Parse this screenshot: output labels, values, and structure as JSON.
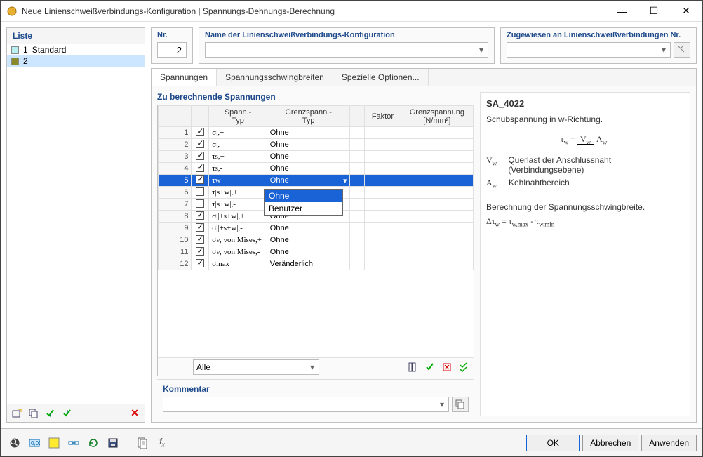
{
  "window": {
    "title": "Neue Linienschweißverbindungs-Konfiguration | Spannungs-Dehnungs-Berechnung"
  },
  "left": {
    "header": "Liste",
    "items": [
      {
        "num": "1",
        "label": "Standard",
        "swatch": "#b8f0f0",
        "selected": false
      },
      {
        "num": "2",
        "label": "",
        "swatch": "#8a8a2a",
        "selected": true
      }
    ]
  },
  "fields": {
    "nr_label": "Nr.",
    "nr_value": "2",
    "name_label": "Name der Linienschweißverbindungs-Konfiguration",
    "name_value": "",
    "assigned_label": "Zugewiesen an Linienschweißverbindungen Nr.",
    "assigned_value": ""
  },
  "tabs": [
    {
      "label": "Spannungen",
      "active": true
    },
    {
      "label": "Spannungsschwingbreiten",
      "active": false
    },
    {
      "label": "Spezielle Optionen...",
      "active": false
    }
  ],
  "section_title": "Zu berechnende Spannungen",
  "grid": {
    "headers": {
      "spann_typ": "Spann.-\nTyp",
      "grenz_typ": "Grenzspann.-\nTyp",
      "faktor": "Faktor",
      "grenzsp": "Grenzspannung\n[N/mm²]"
    },
    "rows": [
      {
        "n": "1",
        "chk": true,
        "typ": "σ|,+",
        "gtyp": "Ohne",
        "sel": false
      },
      {
        "n": "2",
        "chk": true,
        "typ": "σ|,-",
        "gtyp": "Ohne",
        "sel": false
      },
      {
        "n": "3",
        "chk": true,
        "typ": "τs,+",
        "gtyp": "Ohne",
        "sel": false
      },
      {
        "n": "4",
        "chk": true,
        "typ": "τs,-",
        "gtyp": "Ohne",
        "sel": false
      },
      {
        "n": "5",
        "chk": true,
        "typ": "τw",
        "gtyp": "Ohne",
        "sel": true
      },
      {
        "n": "6",
        "chk": false,
        "typ": "τ|s+w|,+",
        "gtyp": "",
        "sel": false
      },
      {
        "n": "7",
        "chk": false,
        "typ": "τ|s+w|,-",
        "gtyp": "",
        "sel": false
      },
      {
        "n": "8",
        "chk": true,
        "typ": "σ||+s+w|,+",
        "gtyp": "Ohne",
        "sel": false
      },
      {
        "n": "9",
        "chk": true,
        "typ": "σ||+s+w|,-",
        "gtyp": "Ohne",
        "sel": false
      },
      {
        "n": "10",
        "chk": true,
        "typ": "σv, von Mises,+",
        "gtyp": "Ohne",
        "sel": false
      },
      {
        "n": "11",
        "chk": true,
        "typ": "σv, von Mises,-",
        "gtyp": "Ohne",
        "sel": false
      },
      {
        "n": "12",
        "chk": true,
        "typ": "σmax",
        "gtyp": "Veränderlich",
        "sel": false
      }
    ],
    "dropdown": {
      "options": [
        "Ohne",
        "Benutzer"
      ],
      "highlighted": 0
    },
    "footer_combo": "Alle"
  },
  "info": {
    "code": "SA_4022",
    "desc": "Schubspannung in w-Richtung.",
    "formula_lhs": "τw",
    "formula_top": "Vw",
    "formula_bot": "Aw",
    "legend": [
      {
        "sym": "Vw",
        "txt": "Querlast der Anschlussnaht (Verbindungsebene)"
      },
      {
        "sym": "Aw",
        "txt": "Kehlnahtbereich"
      }
    ],
    "calc_title": "Berechnung der Spannungsschwingbreite.",
    "calc_formula": "Δτw = τw,max - τw,min"
  },
  "comment": {
    "label": "Kommentar",
    "value": ""
  },
  "buttons": {
    "ok": "OK",
    "cancel": "Abbrechen",
    "apply": "Anwenden"
  }
}
